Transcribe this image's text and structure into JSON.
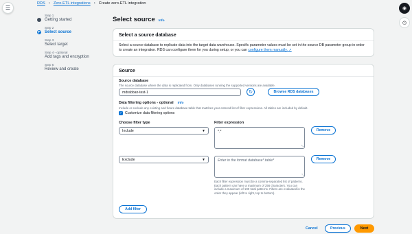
{
  "breadcrumb": {
    "items": [
      "RDS",
      "Zero-ETL integrations"
    ],
    "current": "Create zero-ETL integration"
  },
  "steps": [
    {
      "num": "Step 1",
      "label": "Getting started",
      "state": "done"
    },
    {
      "num": "Step 2",
      "label": "Select source",
      "state": "active"
    },
    {
      "num": "Step 3",
      "label": "Select target",
      "state": "pending"
    },
    {
      "num": "Step 4 - optional",
      "label": "Add tags and encryption",
      "state": "pending"
    },
    {
      "num": "Step 5",
      "label": "Review and create",
      "state": "pending"
    }
  ],
  "page": {
    "title": "Select source",
    "info": "Info"
  },
  "source_db_card": {
    "title": "Select a source database",
    "text": "Select a source database to replicate data into the target data warehouse. Specific parameter values must be set in the source DB parameter group in order to create an integration. RDS can configure them for you during setup, or you can",
    "link": "configure them manually."
  },
  "source_card": {
    "title": "Source",
    "db_label": "Source database",
    "db_desc": "The source database where the data is replicated from. Only databases running the supported versions are available.",
    "db_value": "mdrabban-test-1",
    "browse_button": "Browse RDS databases",
    "filter_label": "Data filtering options - optional",
    "filter_info": "Info",
    "filter_desc": "Include or exclude any existing and future database table that matches your entered list of filter expressions. All tables are included by default.",
    "customize_label": "Customize data filtering options",
    "filter_type_label": "Choose filter type",
    "filter_expr_label": "Filter expression",
    "filters": [
      {
        "type": "Include",
        "expression": "*.*",
        "placeholder": ""
      },
      {
        "type": "Exclude",
        "expression": "",
        "placeholder": "Enter in the format database*.table*"
      }
    ],
    "remove_button": "Remove",
    "help_text": "Each filter expression must be a comma-separated list of patterns. Each pattern can have a maximum of 256 characters. You can include a maximum of 100 total patterns. Filters are evaluated in the order they appear (left to right, top to bottom).",
    "add_filter_button": "Add filter"
  },
  "footer": {
    "cancel": "Cancel",
    "previous": "Previous",
    "next": "Next"
  },
  "colors": {
    "accent": "#0972d3",
    "primary_button": "#ff9900"
  },
  "icons": {
    "menu": "hamburger-icon",
    "refresh": "refresh-icon",
    "external": "external-link-icon"
  }
}
